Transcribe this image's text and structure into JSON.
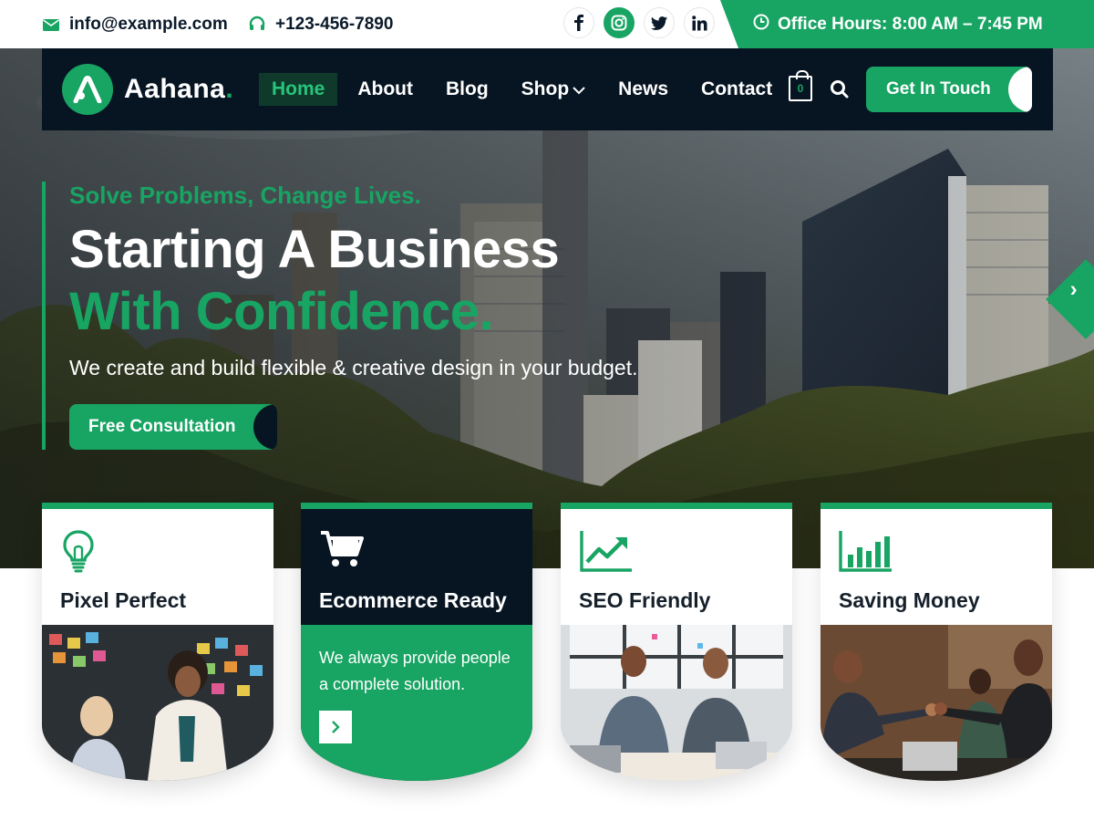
{
  "topbar": {
    "email": "info@example.com",
    "phone": "+123-456-7890",
    "social": [
      {
        "name": "facebook",
        "glyph": "f"
      },
      {
        "name": "instagram",
        "glyph": "◎"
      },
      {
        "name": "twitter",
        "glyph": "🐦"
      },
      {
        "name": "linkedin",
        "glyph": "in"
      }
    ],
    "office_hours": "Office Hours: 8:00 AM – 7:45 PM"
  },
  "header": {
    "logo_text": "Aahana",
    "logo_dot": ".",
    "nav": [
      "Home",
      "About",
      "Blog",
      "Shop",
      "News",
      "Contact"
    ],
    "cart_count": "0",
    "cta": "Get In Touch"
  },
  "hero": {
    "tagline": "Solve Problems, Change Lives.",
    "headline_line1": "Starting A Business",
    "headline_line2": "With Confidence.",
    "subtext": "We create and build flexible & creative design in your budget.",
    "button": "Free Consultation"
  },
  "features": [
    {
      "title": "Pixel Perfect",
      "icon": "lightbulb-icon"
    },
    {
      "title": "Ecommerce Ready",
      "icon": "cart-icon",
      "description": "We always provide people a complete solution."
    },
    {
      "title": "SEO Friendly",
      "icon": "growth-chart-icon"
    },
    {
      "title": "Saving Money",
      "icon": "bar-chart-icon"
    }
  ],
  "colors": {
    "accent": "#18a463",
    "navy": "#071523"
  }
}
